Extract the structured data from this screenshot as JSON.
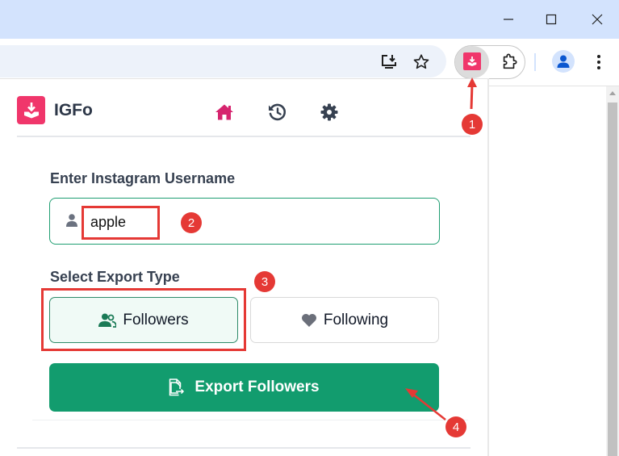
{
  "window": {
    "controls": {
      "minimize": "minimize-icon",
      "maximize": "maximize-icon",
      "close": "close-icon"
    }
  },
  "toolbar": {
    "icons": [
      "install-app-icon",
      "bookmark-star-icon",
      "igfo-extension-icon",
      "extensions-puzzle-icon",
      "profile-avatar-icon",
      "more-menu-icon"
    ]
  },
  "popup": {
    "app_name": "IGFo",
    "nav": [
      {
        "name": "home",
        "icon": "home-icon",
        "active": true
      },
      {
        "name": "history",
        "icon": "history-icon",
        "active": false
      },
      {
        "name": "settings",
        "icon": "gear-icon",
        "active": false
      }
    ],
    "username_label": "Enter Instagram Username",
    "username_value": "apple",
    "export_type_label": "Select Export Type",
    "export_types": [
      {
        "label": "Followers",
        "icon": "users-icon",
        "selected": true
      },
      {
        "label": "Following",
        "icon": "heart-icon",
        "selected": false
      }
    ],
    "export_button_label": "Export Followers"
  },
  "colors": {
    "brand": "#f0366b",
    "accent_green": "#129c6e",
    "nav_active": "#d6246e",
    "annotation_red": "#e53935"
  },
  "annotations": [
    {
      "number": "1",
      "target": "igfo-extension-icon"
    },
    {
      "number": "2",
      "target": "username-input"
    },
    {
      "number": "3",
      "target": "followers-option"
    },
    {
      "number": "4",
      "target": "export-button"
    }
  ]
}
